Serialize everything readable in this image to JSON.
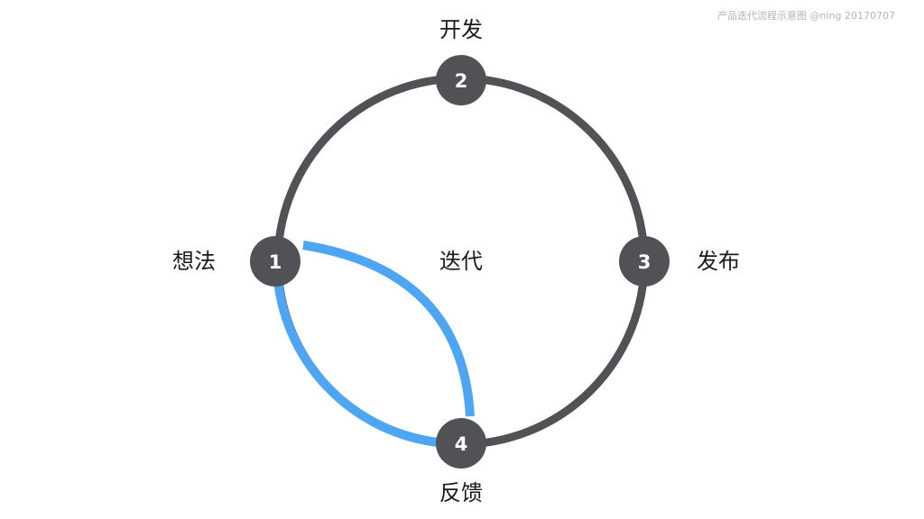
{
  "credit": "产品迭代流程示意图 @ning 20170707",
  "colors": {
    "ring": "#505256",
    "node": "#505256",
    "loop": "#4ea6f2",
    "text": "#1a1a1a"
  },
  "center_label": "迭代",
  "nodes": [
    {
      "number": "1",
      "label": "想法"
    },
    {
      "number": "2",
      "label": "开发"
    },
    {
      "number": "3",
      "label": "发布"
    },
    {
      "number": "4",
      "label": "反馈"
    }
  ]
}
